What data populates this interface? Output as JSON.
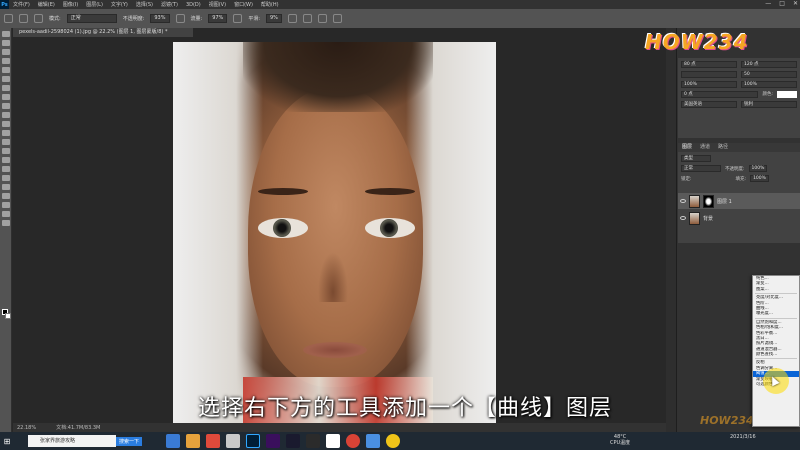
{
  "menubar": {
    "app_logo": "Ps",
    "items": [
      "文件(F)",
      "编辑(E)",
      "图像(I)",
      "图层(L)",
      "文字(Y)",
      "选择(S)",
      "滤镜(T)",
      "3D(D)",
      "视图(V)",
      "窗口(W)",
      "帮助(H)"
    ],
    "window_controls": [
      "—",
      "□",
      "✕"
    ]
  },
  "options_bar": {
    "mode_label": "模式:",
    "mode_value": "正常",
    "opacity_label": "不透明度:",
    "opacity_value": "93%",
    "flow_label": "流量:",
    "flow_value": "97%",
    "smoothing_label": "平滑:",
    "smoothing_value": "9%"
  },
  "document_tab": {
    "title": "pexels-aadil-2598024 (1).jpg @ 22.2% (图层 1, 图层蒙版/8) *"
  },
  "subtitle": "选择右下方的工具添加一个【曲线】图层",
  "status_bar": {
    "zoom": "22.18%",
    "doc_info": "文档:41.7M/83.3M"
  },
  "watermark": {
    "top_text": "HOW234",
    "bottom_text": "HOW234"
  },
  "character_panel": {
    "font_size": "80 点",
    "leading": "120 点",
    "tracking": "50",
    "scale_v": "100%",
    "scale_h": "100%",
    "baseline": "0 点",
    "color_label": "颜色:",
    "language": "美国英语",
    "antialias": "锐利"
  },
  "layers_panel": {
    "tabs": [
      "图层",
      "通道",
      "路径"
    ],
    "filter_label": "类型",
    "blend_mode": "正常",
    "opacity_label": "不透明度:",
    "opacity_value": "100%",
    "lock_label": "锁定:",
    "fill_label": "填充:",
    "fill_value": "100%",
    "layers": [
      {
        "name": "图层 1",
        "selected": true,
        "has_mask": true
      },
      {
        "name": "背景",
        "selected": false,
        "has_mask": false
      }
    ]
  },
  "adjustment_menu": {
    "items": [
      "纯色...",
      "渐变...",
      "图案...",
      "---",
      "亮度/对比度...",
      "色阶...",
      "曲线...",
      "曝光度...",
      "---",
      "自然饱和度...",
      "色相/饱和度...",
      "色彩平衡...",
      "黑白...",
      "照片滤镜...",
      "通道混合器...",
      "颜色查找...",
      "---",
      "反相",
      "色调分离...",
      "阈值...",
      "渐变映射...",
      "可选颜色..."
    ],
    "highlighted_index": 19
  },
  "taskbar": {
    "search_text": "搜索一下",
    "search_placeholder": "张家界旅游攻略",
    "temperature": "48°C",
    "cpu_label": "CPU温度",
    "time": "",
    "date": "2021/3/16"
  }
}
